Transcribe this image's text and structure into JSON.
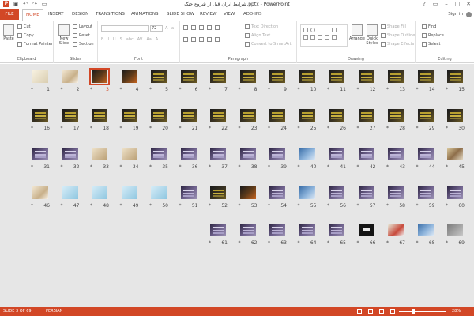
{
  "app": {
    "title": "شرایط ایران قبل از شروع جنگ.pptx - PowerPoint",
    "signin": "Sign in",
    "window_controls": [
      "?",
      "▭",
      "–",
      "□",
      "✕"
    ]
  },
  "qat": [
    "save-icon",
    "undo-icon",
    "redo-icon",
    "slideshow-icon"
  ],
  "tabs": [
    {
      "label": "FILE",
      "kind": "file"
    },
    {
      "label": "HOME",
      "kind": "active"
    },
    {
      "label": "INSERT"
    },
    {
      "label": "DESIGN"
    },
    {
      "label": "TRANSITIONS"
    },
    {
      "label": "ANIMATIONS"
    },
    {
      "label": "SLIDE SHOW"
    },
    {
      "label": "REVIEW"
    },
    {
      "label": "VIEW"
    },
    {
      "label": "ADD-INS"
    }
  ],
  "ribbon": {
    "clipboard": {
      "label": "Clipboard",
      "paste": "Paste",
      "cut": "Cut",
      "copy": "Copy",
      "format_painter": "Format Painter"
    },
    "slides": {
      "label": "Slides",
      "new_slide": "New Slide",
      "layout": "Layout",
      "reset": "Reset",
      "section": "Section"
    },
    "font": {
      "label": "Font",
      "size_value": "72",
      "font_value": ""
    },
    "paragraph": {
      "label": "Paragraph",
      "text_direction": "Text Direction",
      "align_text": "Align Text",
      "convert": "Convert to SmartArt"
    },
    "drawing": {
      "label": "Drawing",
      "arrange": "Arrange",
      "quick_styles": "Quick Styles",
      "shape_fill": "Shape Fill",
      "shape_outline": "Shape Outline",
      "shape_effects": "Shape Effects"
    },
    "editing": {
      "label": "Editing",
      "find": "Find",
      "replace": "Replace",
      "select": "Select"
    }
  },
  "slides": [
    {
      "n": "15",
      "style": "dark"
    },
    {
      "n": "14",
      "style": "dark"
    },
    {
      "n": "13",
      "style": "dark"
    },
    {
      "n": "12",
      "style": "dark"
    },
    {
      "n": "11",
      "style": "dark"
    },
    {
      "n": "10",
      "style": "dark"
    },
    {
      "n": "9",
      "style": "dark"
    },
    {
      "n": "8",
      "style": "dark"
    },
    {
      "n": "7",
      "style": "dark"
    },
    {
      "n": "6",
      "style": "dark"
    },
    {
      "n": "5",
      "style": "dark"
    },
    {
      "n": "4",
      "style": "orange"
    },
    {
      "n": "3",
      "style": "orange",
      "selected": true
    },
    {
      "n": "2",
      "style": "light"
    },
    {
      "n": "1",
      "style": "cream"
    },
    {
      "n": "30",
      "style": "dark"
    },
    {
      "n": "29",
      "style": "dark"
    },
    {
      "n": "28",
      "style": "dark"
    },
    {
      "n": "27",
      "style": "dark"
    },
    {
      "n": "26",
      "style": "dark"
    },
    {
      "n": "25",
      "style": "dark"
    },
    {
      "n": "24",
      "style": "dark"
    },
    {
      "n": "23",
      "style": "dark"
    },
    {
      "n": "22",
      "style": "dark"
    },
    {
      "n": "21",
      "style": "dark"
    },
    {
      "n": "20",
      "style": "dark"
    },
    {
      "n": "19",
      "style": "dark"
    },
    {
      "n": "18",
      "style": "dark"
    },
    {
      "n": "17",
      "style": "dark"
    },
    {
      "n": "16",
      "style": "dark"
    },
    {
      "n": "45",
      "style": "photo"
    },
    {
      "n": "44",
      "style": "purple"
    },
    {
      "n": "43",
      "style": "purple"
    },
    {
      "n": "42",
      "style": "purple"
    },
    {
      "n": "41",
      "style": "purple"
    },
    {
      "n": "40",
      "style": "blue"
    },
    {
      "n": "39",
      "style": "purple"
    },
    {
      "n": "38",
      "style": "purple"
    },
    {
      "n": "37",
      "style": "purple"
    },
    {
      "n": "36",
      "style": "purple"
    },
    {
      "n": "35",
      "style": "purple"
    },
    {
      "n": "34",
      "style": "beige"
    },
    {
      "n": "33",
      "style": "beige"
    },
    {
      "n": "32",
      "style": "purple"
    },
    {
      "n": "31",
      "style": "purple"
    },
    {
      "n": "60",
      "style": "purple"
    },
    {
      "n": "59",
      "style": "purple"
    },
    {
      "n": "58",
      "style": "purple"
    },
    {
      "n": "57",
      "style": "purple"
    },
    {
      "n": "56",
      "style": "purple"
    },
    {
      "n": "55",
      "style": "blue"
    },
    {
      "n": "54",
      "style": "purple"
    },
    {
      "n": "53",
      "style": "orange"
    },
    {
      "n": "52",
      "style": "dark"
    },
    {
      "n": "51",
      "style": "purple"
    },
    {
      "n": "50",
      "style": "pale"
    },
    {
      "n": "49",
      "style": "pale"
    },
    {
      "n": "48",
      "style": "pale"
    },
    {
      "n": "47",
      "style": "pale"
    },
    {
      "n": "46",
      "style": "light"
    },
    {
      "n": "69",
      "style": "gray"
    },
    {
      "n": "68",
      "style": "blue"
    },
    {
      "n": "67",
      "style": "green"
    },
    {
      "n": "66",
      "style": "black"
    },
    {
      "n": "65",
      "style": "purple"
    },
    {
      "n": "64",
      "style": "purple"
    },
    {
      "n": "63",
      "style": "purple"
    },
    {
      "n": "62",
      "style": "purple"
    },
    {
      "n": "61",
      "style": "purple"
    }
  ],
  "status": {
    "slide_info": "SLIDE 3 OF 69",
    "language": "PERSIAN",
    "zoom": "28%",
    "zoom_fraction": 0.28
  },
  "colors": {
    "accent": "#d24726",
    "sorter_bg": "#e6e6e6"
  }
}
